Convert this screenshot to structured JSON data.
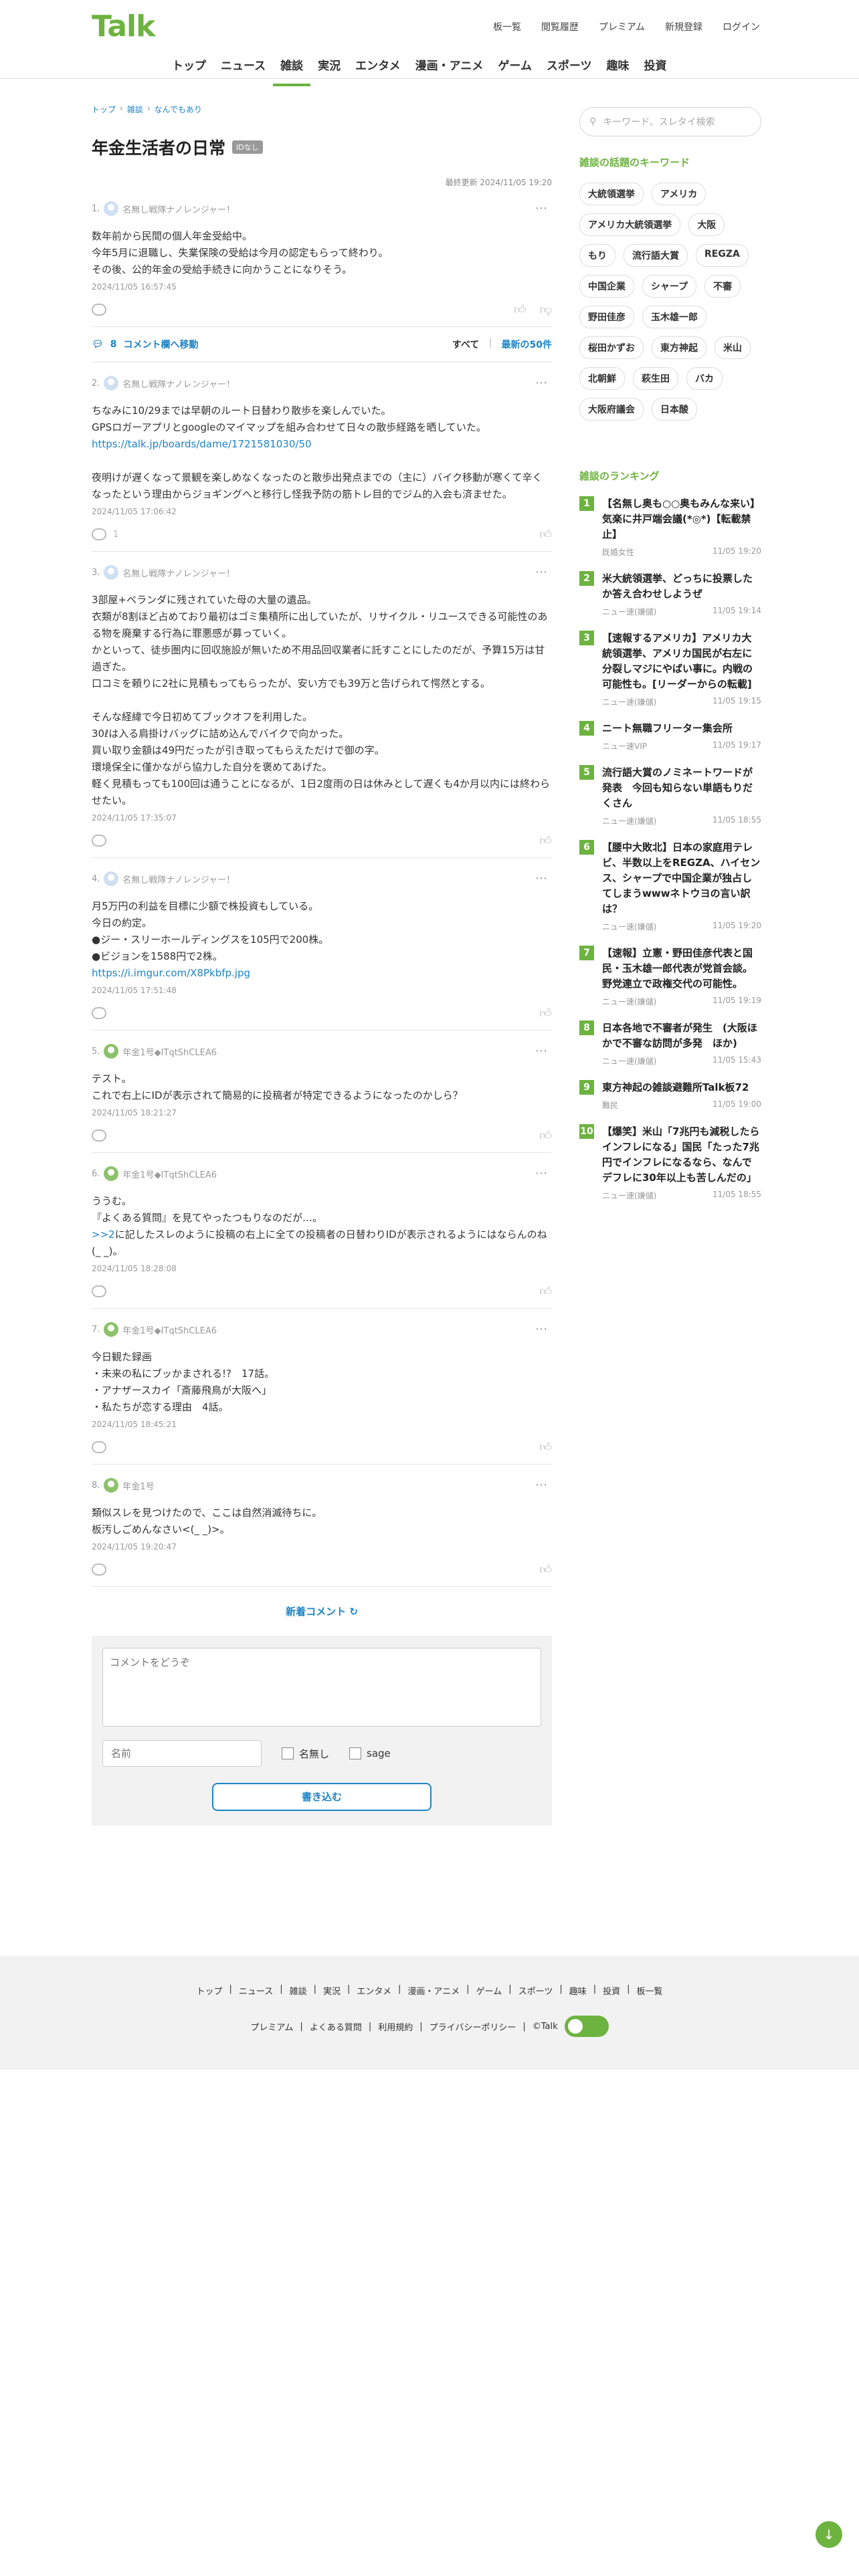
{
  "header": {
    "logo": "Talk",
    "topnav": [
      "板一覧",
      "閲覧履歴",
      "プレミアム",
      "新規登録",
      "ログイン"
    ],
    "categories": [
      "トップ",
      "ニュース",
      "雑談",
      "実況",
      "エンタメ",
      "漫画・アニメ",
      "ゲーム",
      "スポーツ",
      "趣味",
      "投資"
    ]
  },
  "breadcrumb": [
    "トップ",
    "雑談",
    "なんでもあり"
  ],
  "thread": {
    "title": "年金生活者の日常",
    "badge": "IDなし",
    "updated": "最終更新 2024/11/05 19:20"
  },
  "comment_bar": {
    "count": "8",
    "link": "コメント欄へ移動",
    "all": "すべて",
    "latest": "最新の50件"
  },
  "comments": [
    {
      "num": "1.",
      "name": "名無し戦隊ナノレンジャー！",
      "body": "数年前から民間の個人年金受給中。\n今年5月に退職し、失業保険の受給は今月の認定もらって終わり。\nその後、公的年金の受給手続きに向かうことになりそう。",
      "date": "2024/11/05 16:57:45"
    },
    {
      "num": "2.",
      "name": "名無し戦隊ナノレンジャー！",
      "body": "ちなみに10/29までは早朝のルート日替わり散歩を楽しんでいた。\nGPSロガーアプリとgoogleのマイマップを組み合わせて日々の散歩経路を晒していた。",
      "link": "https://talk.jp/boards/dame/1721581030/50",
      "body2": "夜明けが遅くなって景観を楽しめなくなったのと散歩出発点までの（主に）バイク移動が寒くて辛くなったという理由からジョギングへと移行し怪我予防の筋トレ目的でジム的入会も済ませた。",
      "date": "2024/11/05 17:06:42",
      "replies": "1"
    },
    {
      "num": "3.",
      "name": "名無し戦隊ナノレンジャー！",
      "body": "3部屋+ベランダに残されていた母の大量の遺品。\n衣類が8割ほど占めており最初はゴミ集積所に出していたが、リサイクル・リユースできる可能性のある物を廃棄する行為に罪悪感が募っていく。\nかといって、徒歩圏内に回収施設が無いため不用品回収業者に託すことにしたのだが、予算15万は甘過ぎた。\n口コミを頼りに2社に見積もってもらったが、安い方でも39万と告げられて愕然とする。\n\nそんな経緯で今日初めてブックオフを利用した。\n30ℓは入る肩掛けバッグに詰め込んでバイクで向かった。\n買い取り金額は49円だったが引き取ってもらえただけで御の字。\n環境保全に僅かながら協力した自分を褒めてあげた。\n軽く見積もっても100回は通うことになるが、1日2度雨の日は休みとして遅くも4か月以内には終わらせたい。",
      "date": "2024/11/05 17:35:07"
    },
    {
      "num": "4.",
      "name": "名無し戦隊ナノレンジャー！",
      "body": "月5万円の利益を目標に少額で株投資もしている。\n今日の約定。\n●ジー・スリーホールディングスを105円で200株。\n●ビジョンを1588円で2株。",
      "link": "https://i.imgur.com/X8Pkbfp.jpg",
      "date": "2024/11/05 17:51:48"
    },
    {
      "num": "5.",
      "name": "年金1号◆ITqtShCLEA6",
      "body": "テスト。\nこれで右上にIDが表示されて簡易的に投稿者が特定できるようになったのかしら？",
      "date": "2024/11/05 18:21:27"
    },
    {
      "num": "6.",
      "name": "年金1号◆ITqtShCLEA6",
      "body": "ううむ。\n『よくある質問』を見てやったつもりなのだが…。",
      "link": ">>2",
      "body2": "に記したスレのように投稿の右上に全ての投稿者の日替わりIDが表示されるようにはならんのね(_ _)。",
      "date": "2024/11/05 18:28:08"
    },
    {
      "num": "7.",
      "name": "年金1号◆ITqtShCLEA6",
      "body": "今日観た録画\n・未来の私にブッかまされる!?　17話。\n・アナザースカイ「斎藤飛鳥が大阪へ」\n・私たちが恋する理由　4話。",
      "date": "2024/11/05 18:45:21"
    },
    {
      "num": "8.",
      "name": "年金1号",
      "body": "類似スレを見つけたので、ここは自然消滅待ちに。\n板汚しごめんなさい<(_ _)>。",
      "date": "2024/11/05 19:20:47"
    }
  ],
  "new_comments": "新着コメント",
  "form": {
    "placeholder": "コメントをどうぞ",
    "name_placeholder": "名前",
    "anon": "名無し",
    "sage": "sage",
    "submit": "書き込む"
  },
  "sidebar": {
    "search_placeholder": "キーワード、スレタイ検索",
    "keywords_title": "雑談の話題のキーワード",
    "keywords": [
      "大統領選挙",
      "アメリカ",
      "アメリカ大統領選挙",
      "大阪",
      "もり",
      "流行語大賞",
      "REGZA",
      "中国企業",
      "シャープ",
      "不審",
      "野田佳彦",
      "玉木雄一郎",
      "桜田かずお",
      "東方神起",
      "米山",
      "北朝鮮",
      "萩生田",
      "バカ",
      "大阪府議会",
      "日本酸"
    ],
    "ranking_title": "雑談のランキング",
    "ranking": [
      {
        "n": "1",
        "title": "【名無し奥も○○奥もみんな来い】気楽に井戸端会議(*◎*)【転載禁止】",
        "src": "既婚女性",
        "time": "11/05 19:20"
      },
      {
        "n": "2",
        "title": "米大統領選挙、どっちに投票したか答え合わせしようぜ",
        "src": "ニュー速(嫌儲)",
        "time": "11/05 19:14"
      },
      {
        "n": "3",
        "title": "【速報するアメリカ】アメリカ大統領選挙、アメリカ国民が右左に分裂しマジにやばい事に。内戦の可能性も。[リーダーからの転載]",
        "src": "ニュー速(嫌儲)",
        "time": "11/05 19:15"
      },
      {
        "n": "4",
        "title": "ニート無職フリーター集会所",
        "src": "ニュー速VIP",
        "time": "11/05 19:17"
      },
      {
        "n": "5",
        "title": "流行語大賞のノミネートワードが発表　今回も知らない単語もりだくさん",
        "src": "ニュー速(嫌儲)",
        "time": "11/05 18:55"
      },
      {
        "n": "6",
        "title": "【腰中大敗北】日本の家庭用テレビ、半数以上をREGZA、ハイセンス、シャープで中国企業が独占してしまうwwwネトウヨの言い訳は？",
        "src": "ニュー速(嫌儲)",
        "time": "11/05 19:20"
      },
      {
        "n": "7",
        "title": "【速報】立憲・野田佳彦代表と国民・玉木雄一郎代表が党首会談。野党連立で政権交代の可能性。",
        "src": "ニュー速(嫌儲)",
        "time": "11/05 19:19"
      },
      {
        "n": "8",
        "title": "日本各地で不審者が発生　(大阪ほかで不審な訪問が多発　ほか)",
        "src": "ニュー速(嫌儲)",
        "time": "11/05 15:43"
      },
      {
        "n": "9",
        "title": "東方神起の雑談避難所Talk板72",
        "src": "難民",
        "time": "11/05 19:00"
      },
      {
        "n": "10",
        "title": "【爆笑】米山「7兆円も減税したらインフレになる」国民「たった7兆円でインフレになるなら、なんでデフレに30年以上も苦しんだの」",
        "src": "ニュー速(嫌儲)",
        "time": "11/05 18:55"
      }
    ]
  },
  "footer": {
    "row1": [
      "トップ",
      "ニュース",
      "雑談",
      "実況",
      "エンタメ",
      "漫画・アニメ",
      "ゲーム",
      "スポーツ",
      "趣味",
      "投資",
      "板一覧"
    ],
    "row2": [
      "プレミアム",
      "よくある質問",
      "利用規約",
      "プライバシーポリシー",
      "©Talk"
    ]
  }
}
